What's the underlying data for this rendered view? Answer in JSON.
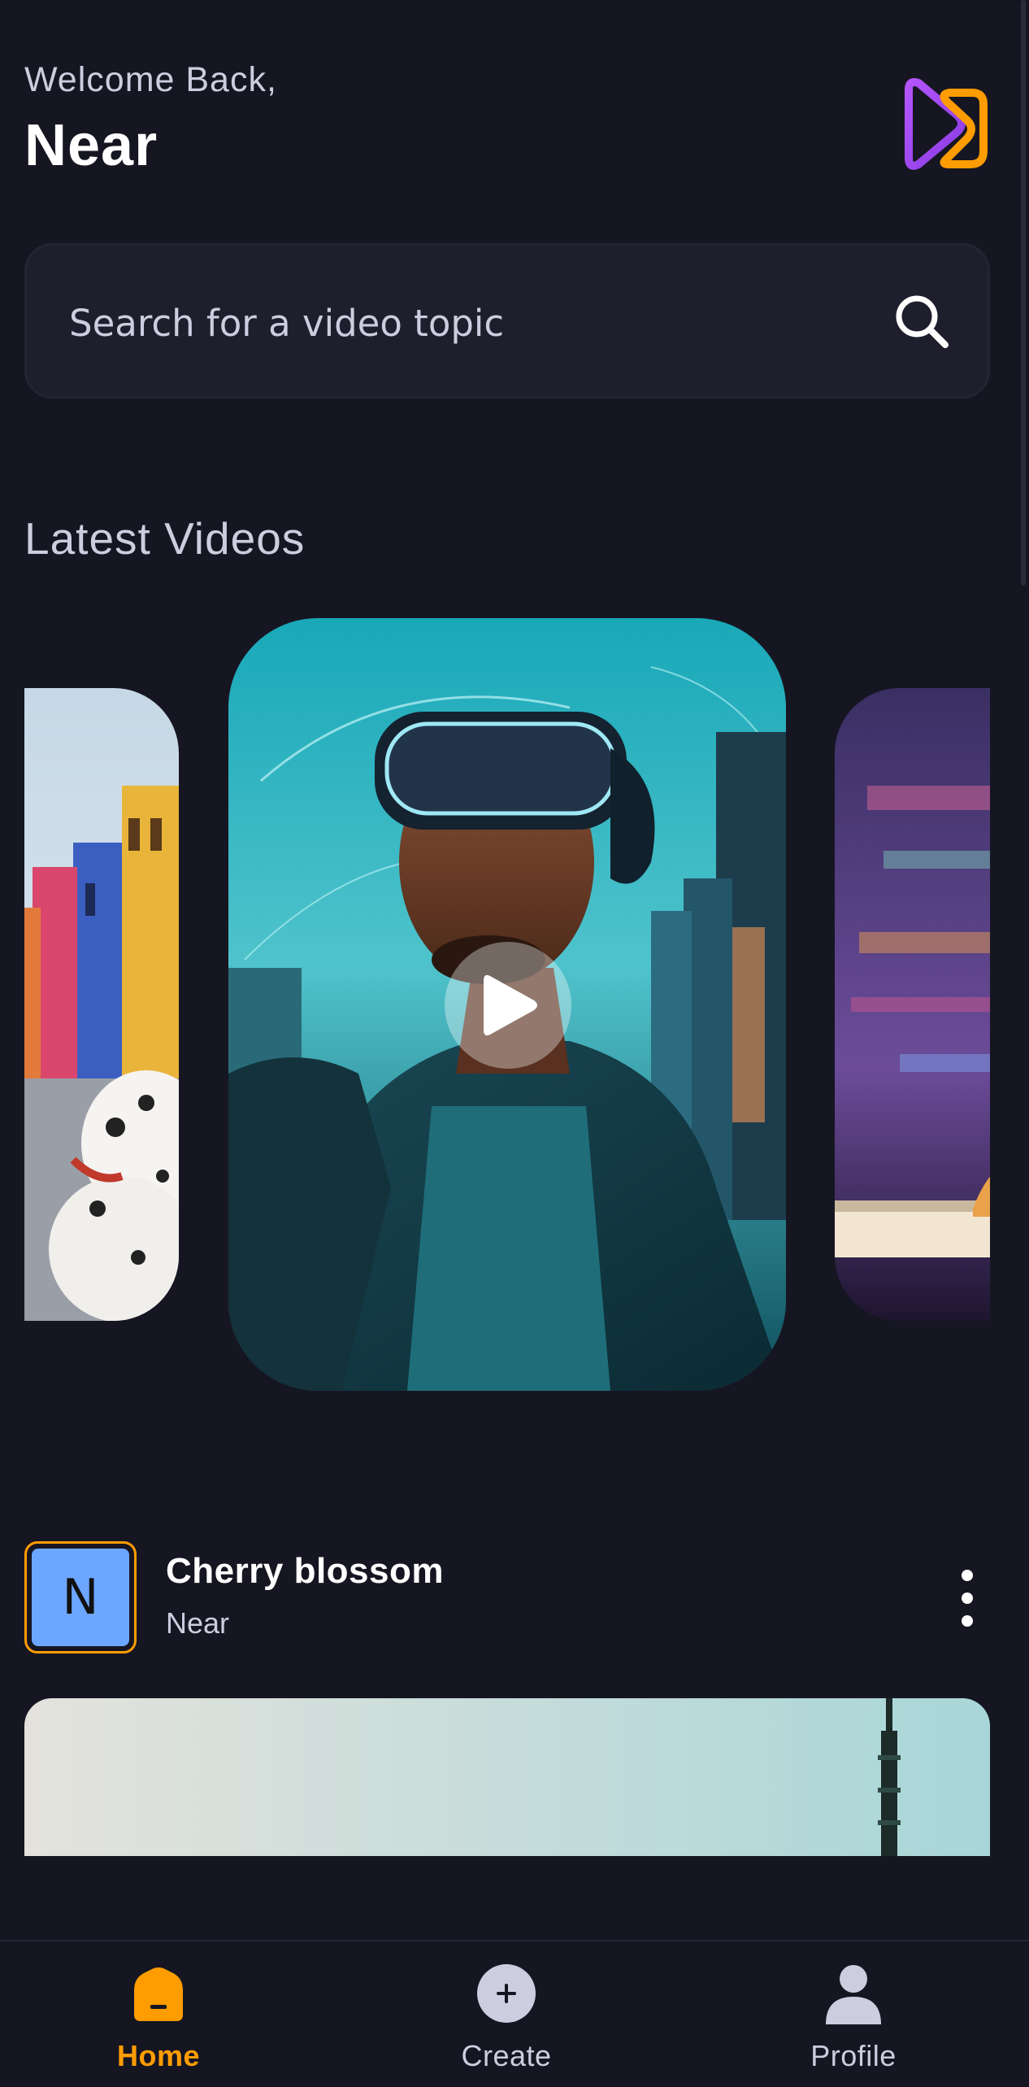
{
  "header": {
    "greeting": "Welcome Back,",
    "username": "Near",
    "logo_icon": "app-logo-icon"
  },
  "search": {
    "placeholder": "Search for a video topic",
    "value": "",
    "icon": "search-icon"
  },
  "latest": {
    "title": "Latest Videos",
    "items": [
      {
        "thumbnail": "dalmatian-street"
      },
      {
        "thumbnail": "vr-headset-man",
        "active": true
      },
      {
        "thumbnail": "keyboard-hands"
      }
    ]
  },
  "post": {
    "avatar_letter": "N",
    "title": "Cherry blossom",
    "author": "Near",
    "menu_icon": "more-vertical-icon"
  },
  "tabs": [
    {
      "label": "Home",
      "icon": "home-icon",
      "active": true
    },
    {
      "label": "Create",
      "icon": "plus-circle-icon",
      "active": false
    },
    {
      "label": "Profile",
      "icon": "user-icon",
      "active": false
    }
  ],
  "colors": {
    "background": "#161622",
    "card": "#1E1E2D",
    "accent": "#FF9C01",
    "muted_text": "#CDCDE0"
  }
}
